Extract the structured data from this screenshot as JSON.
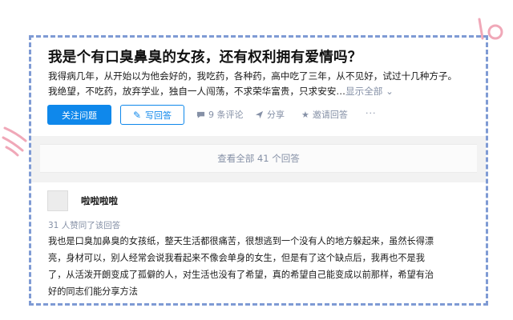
{
  "question": {
    "title": "我是个有口臭鼻臭的女孩，还有权利拥有爱情吗？",
    "desc_line1": "我得病几年，从开始以为他会好的，我吃药，各种药，高中吃了三年，从不见好，试过十几种方子。",
    "desc_line2": "我绝望，不吃药，放弃学业，独自一人闯荡，不求荣华富贵，只求安安…",
    "show_all": "显示全部 ⌄"
  },
  "actions": {
    "follow_label": "关注问题",
    "answer_label": "写回答",
    "comments_label": "9 条评论",
    "share_label": "分享",
    "invite_label": "邀请回答",
    "more_label": "···"
  },
  "view_all_label": "查看全部 41 个回答",
  "answer": {
    "author": "啦啦啦啦",
    "agree_text": "31 人赞同了该回答",
    "lines": [
      "我也是口臭加鼻臭的女孩纸，整天生活都很痛苦，很想逃到一个没有人的地方躲起来，虽然长得漂",
      "亮，身材可以，别人经常会说我看起来不像会单身的女生，但是有了这个缺点后，我再也不是我",
      "了，从活泼开朗变成了孤僻的人，对生活也没有了希望，真的希望自己能变成以前那样，希望有治",
      "好的同志们能分享方法"
    ]
  },
  "colors": {
    "primary": "#0f88eb",
    "meta": "#8590a6",
    "frame": "#7f9bd4",
    "doodle": "#f0a8b8"
  },
  "icons": [
    "pen-icon",
    "comment-icon",
    "share-icon",
    "star-icon",
    "more-icon"
  ]
}
